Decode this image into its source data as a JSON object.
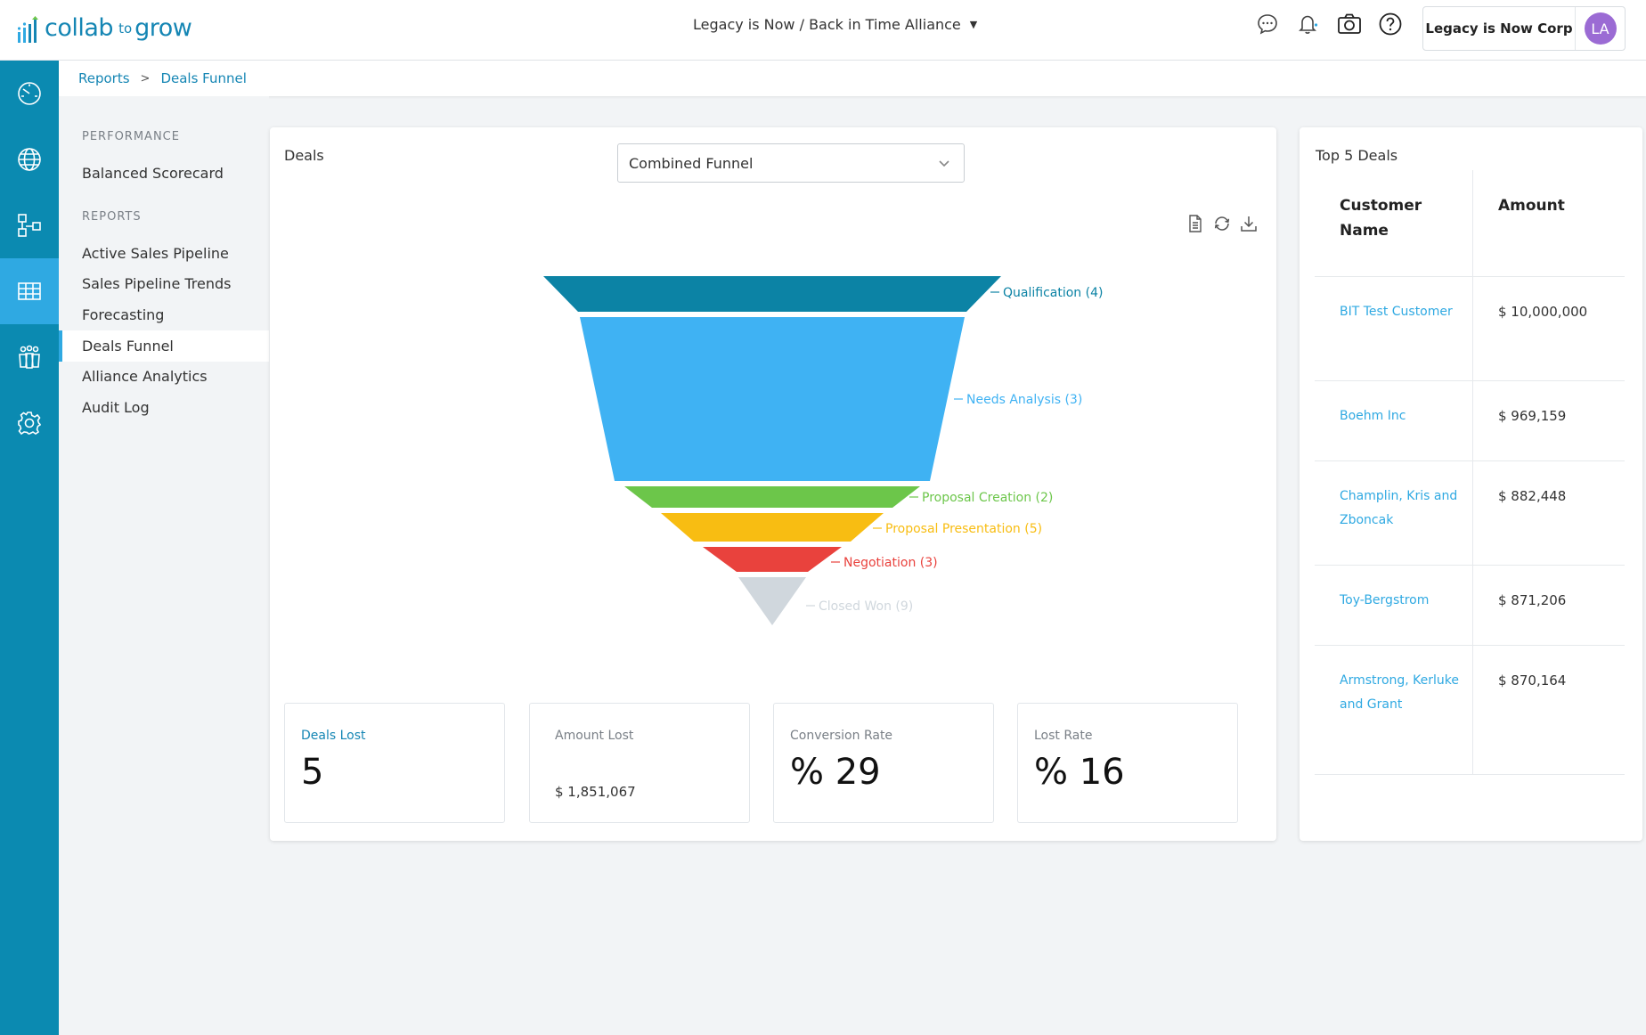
{
  "brand": {
    "name_part1": "collab",
    "name_part2": "to",
    "name_part3": "grow",
    "color": "#1586b4"
  },
  "header": {
    "alliance": "Legacy is Now / Back in Time Alliance",
    "company": "Legacy is Now Corp",
    "avatar_initials": "LA",
    "icons": [
      "chat-icon",
      "bell-icon",
      "camera-icon",
      "help-icon"
    ]
  },
  "rail": {
    "items": [
      "dashboard-icon",
      "globe-icon",
      "workflow-icon",
      "table-icon",
      "people-icon",
      "gear-icon"
    ],
    "active_index": 3
  },
  "breadcrumb": {
    "root": "Reports",
    "current": "Deals Funnel"
  },
  "subnav": {
    "performance_heading": "PERFORMANCE",
    "performance_items": [
      "Balanced Scorecard"
    ],
    "reports_heading": "REPORTS",
    "reports_items": [
      "Active Sales Pipeline",
      "Sales Pipeline Trends",
      "Forecasting",
      "Deals Funnel",
      "Alliance Analytics",
      "Audit Log"
    ],
    "active_item": "Deals Funnel"
  },
  "deals": {
    "title": "Deals",
    "funnel_select": "Combined Funnel",
    "chart_icons": [
      "document-icon",
      "refresh-icon",
      "download-icon"
    ]
  },
  "chart_data": {
    "type": "funnel",
    "stages": [
      {
        "label": "Qualification (4)",
        "name": "Qualification",
        "count": 4,
        "color": "#0c83a5"
      },
      {
        "label": "Needs Analysis (3)",
        "name": "Needs Analysis",
        "count": 3,
        "color": "#3fb2f3"
      },
      {
        "label": "Proposal Creation (2)",
        "name": "Proposal Creation",
        "count": 2,
        "color": "#6cc64a"
      },
      {
        "label": "Proposal Presentation (5)",
        "name": "Proposal Presentation",
        "count": 5,
        "color": "#f8bd12"
      },
      {
        "label": "Negotiation (3)",
        "name": "Negotiation",
        "count": 3,
        "color": "#e9423d"
      },
      {
        "label": "Closed Won (9)",
        "name": "Closed Won",
        "count": 9,
        "color": "#d0d7dd"
      }
    ]
  },
  "stats": [
    {
      "label": "Deals Lost",
      "value": "5",
      "style": "big",
      "label_color": "blue"
    },
    {
      "label": "Amount Lost",
      "value": "$ 1,851,067",
      "style": "small",
      "label_color": "gray"
    },
    {
      "label": "Conversion Rate",
      "value": "% 29",
      "style": "big",
      "label_color": "gray"
    },
    {
      "label": "Lost Rate",
      "value": "% 16",
      "style": "big",
      "label_color": "gray"
    }
  ],
  "top5": {
    "title": "Top 5 Deals",
    "col_customer": "Customer Name",
    "col_amount": "Amount",
    "rows": [
      {
        "customer": "BIT Test Customer",
        "amount": "$ 10,000,000"
      },
      {
        "customer": "Boehm Inc",
        "amount": "$ 969,159"
      },
      {
        "customer": "Champlin, Kris and Zboncak",
        "amount": "$ 882,448"
      },
      {
        "customer": "Toy-Bergstrom",
        "amount": "$ 871,206"
      },
      {
        "customer": "Armstrong, Kerluke and Grant",
        "amount": "$ 870,164"
      }
    ]
  }
}
